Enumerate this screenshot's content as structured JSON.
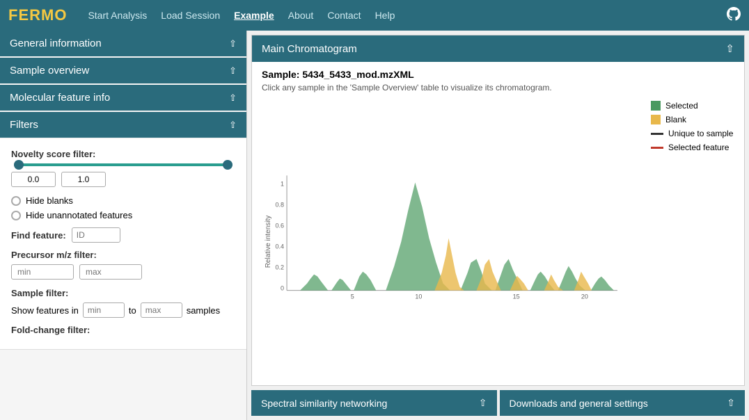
{
  "navbar": {
    "logo": "FERMO",
    "links": [
      {
        "label": "Start Analysis",
        "active": false
      },
      {
        "label": "Load Session",
        "active": false
      },
      {
        "label": "Example",
        "active": true
      },
      {
        "label": "About",
        "active": false
      },
      {
        "label": "Contact",
        "active": false
      },
      {
        "label": "Help",
        "active": false
      }
    ],
    "github_icon": "⬡"
  },
  "sidebar": {
    "sections": [
      {
        "label": "General information",
        "id": "general-info"
      },
      {
        "label": "Sample overview",
        "id": "sample-overview"
      },
      {
        "label": "Molecular feature info",
        "id": "molecular-feature"
      },
      {
        "label": "Filters",
        "id": "filters"
      }
    ]
  },
  "filters": {
    "novelty_label": "Novelty score filter:",
    "range_min": "0.0",
    "range_max": "1.0",
    "hide_blanks_label": "Hide blanks",
    "hide_unannotated_label": "Hide unannotated features",
    "find_feature_label": "Find feature:",
    "find_feature_placeholder": "ID",
    "precursor_label": "Precursor m/z filter:",
    "precursor_min_placeholder": "min",
    "precursor_max_placeholder": "max",
    "sample_filter_label": "Sample filter:",
    "sample_show_label": "Show features in",
    "sample_min_placeholder": "min",
    "sample_to_label": "to",
    "sample_max_placeholder": "max",
    "sample_samples_label": "samples",
    "fold_change_label": "Fold-change filter:"
  },
  "chromatogram": {
    "header": "Main Chromatogram",
    "sample_title": "Sample: 5434_5433_mod.mzXML",
    "sample_subtitle": "Click any sample in the 'Sample Overview' table to visualize its chromatogram.",
    "legend": [
      {
        "label": "Selected",
        "type": "swatch",
        "color": "#4a9a60"
      },
      {
        "label": "Blank",
        "type": "swatch",
        "color": "#e8b84b"
      },
      {
        "label": "Unique to sample",
        "type": "line",
        "color": "#333"
      },
      {
        "label": "Selected feature",
        "type": "line",
        "color": "#c0392b"
      }
    ],
    "x_labels": [
      "5",
      "10",
      "15",
      "20"
    ],
    "y_labels": [
      "0",
      "0.2",
      "0.4",
      "0.6",
      "0.8",
      "1"
    ]
  },
  "bottom_panels": [
    {
      "label": "Spectral similarity networking",
      "id": "spectral"
    },
    {
      "label": "Downloads and general settings",
      "id": "downloads"
    }
  ]
}
